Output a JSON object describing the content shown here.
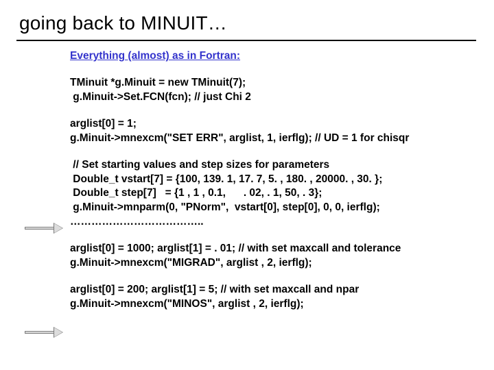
{
  "title": "going back to MINUIT…",
  "subtitle": "Everything (almost) as in Fortran:",
  "code": {
    "block1": {
      "l1": "TMinuit *g.Minuit = new TMinuit(7);",
      "l2": " g.Minuit->Set.FCN(fcn); // just Chi 2"
    },
    "block2": {
      "l1": "arglist[0] = 1;",
      "l2": "g.Minuit->mnexcm(\"SET ERR\", arglist, 1, ierflg); // UD = 1 for chisqr"
    },
    "block3": {
      "l1": " // Set starting values and step sizes for parameters",
      "l2": " Double_t vstart[7] = {100, 139. 1, 17. 7, 5. , 180. , 20000. , 30. };",
      "l3": " Double_t step[7]   = {1 , 1 , 0.1,      . 02, . 1, 50, . 3};",
      "l4": " g.Minuit->mnparm(0, \"PNorm\",  vstart[0], step[0], 0, 0, ierflg);",
      "l5": "……………………………….."
    },
    "block4": {
      "l1": "arglist[0] = 1000; arglist[1] = . 01; // with set maxcall and tolerance",
      "l2": "g.Minuit->mnexcm(\"MIGRAD\", arglist , 2, ierflg);"
    },
    "block5": {
      "l1": "arglist[0] = 200; arglist[1] = 5; // with set maxcall and npar",
      "l2": "g.Minuit->mnexcm(\"MINOS\", arglist , 2, ierflg);"
    }
  },
  "icons": {
    "arrow": "right-arrow-icon"
  }
}
